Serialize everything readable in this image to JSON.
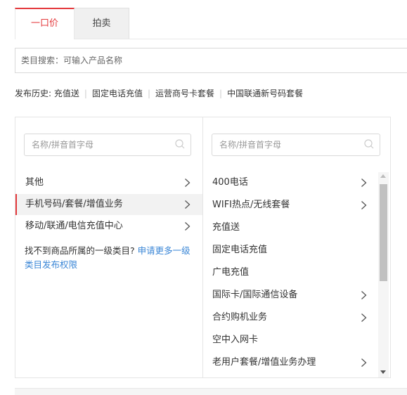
{
  "tabs": [
    {
      "label": "一口价",
      "active": true
    },
    {
      "label": "拍卖",
      "active": false
    }
  ],
  "search": {
    "placeholder": "类目搜索：可输入产品名称"
  },
  "history": {
    "label": "发布历史:",
    "items": [
      "充值送",
      "固定电话充值",
      "运营商号卡套餐",
      "中国联通新号码套餐"
    ]
  },
  "left_column": {
    "filter_placeholder": "名称/拼音首字母",
    "items": [
      {
        "label": "其他",
        "has_children": true,
        "selected": false
      },
      {
        "label": "手机号码/套餐/增值业务",
        "has_children": true,
        "selected": true
      },
      {
        "label": "移动/联通/电信充值中心",
        "has_children": true,
        "selected": false
      }
    ],
    "notice_text": "找不到商品所属的一级类目?",
    "notice_link": "申请更多一级类目发布权限"
  },
  "right_column": {
    "filter_placeholder": "名称/拼音首字母",
    "items": [
      {
        "label": "400电话",
        "has_children": true
      },
      {
        "label": "WIFI热点/无线套餐",
        "has_children": true
      },
      {
        "label": "充值送",
        "has_children": false
      },
      {
        "label": "固定电话充值",
        "has_children": false
      },
      {
        "label": "广电充值",
        "has_children": false
      },
      {
        "label": "国际卡/国际通信设备",
        "has_children": true
      },
      {
        "label": "合约购机业务",
        "has_children": true
      },
      {
        "label": "空中入网卡",
        "has_children": false
      },
      {
        "label": "老用户套餐/增值业务办理",
        "has_children": true
      }
    ]
  },
  "colors": {
    "accent": "#e4393c",
    "link": "#3a86d6"
  },
  "icons": {
    "filter": "search-icon",
    "row": "chevron-right-icon"
  }
}
